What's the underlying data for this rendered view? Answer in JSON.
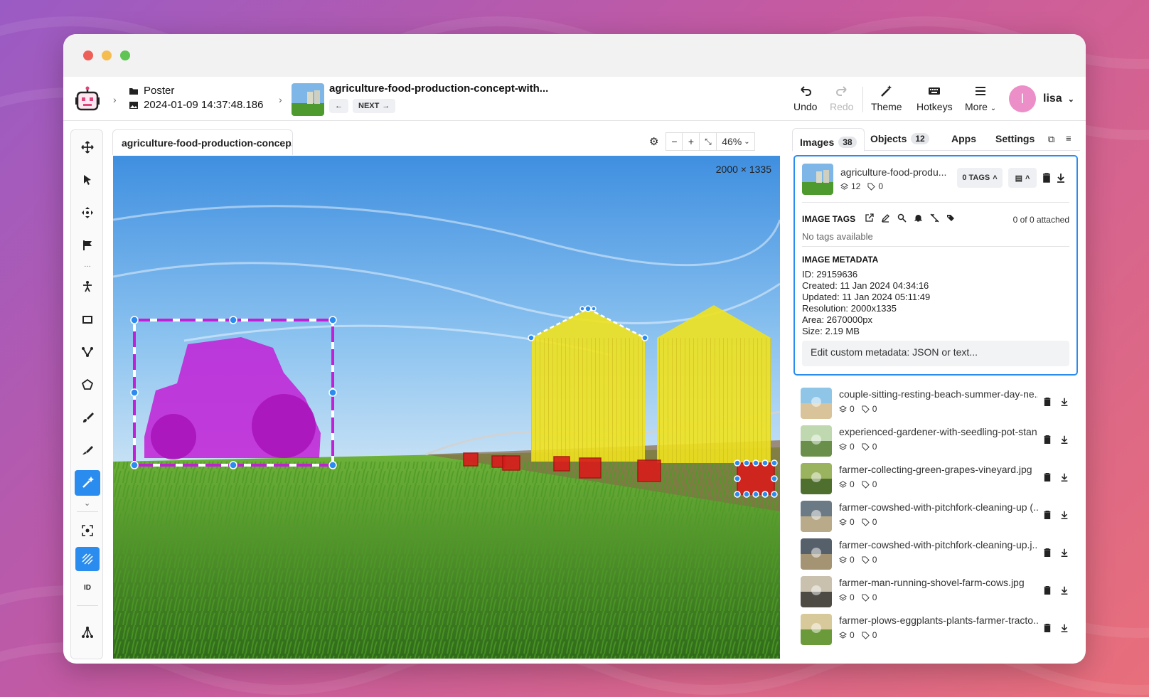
{
  "app": {
    "logo": "robot-logo-icon"
  },
  "breadcrumb": {
    "project": "Poster",
    "dataset": "2024-01-09 14:37:48.186"
  },
  "image": {
    "title": "agriculture-food-production-concept-with...",
    "prev_label": "",
    "next_label": "NEXT",
    "tab_label": "agriculture-food-production-concep...",
    "resolution_label": "2000 × 1335",
    "zoom": "46%"
  },
  "toolbar_top": {
    "undo": "Undo",
    "redo": "Redo",
    "theme": "Theme",
    "hotkeys": "Hotkeys",
    "more": "More",
    "user": "lisa",
    "user_initial": "l"
  },
  "tools": [
    "move-icon",
    "pointer-icon",
    "pan-icon",
    "flag-icon",
    "keypoint-icon",
    "rectangle-icon",
    "polyline-icon",
    "polygon-icon",
    "brush-icon",
    "eraser-icon",
    "smart-tool-icon",
    "focus-icon",
    "hatch-icon",
    "id-icon",
    "graph-icon"
  ],
  "tool_id_label": "ID",
  "right_tabs": {
    "images": "Images",
    "images_count": "38",
    "objects": "Objects",
    "objects_count": "12",
    "apps": "Apps",
    "settings": "Settings"
  },
  "selected_image": {
    "name": "agriculture-food-produ...",
    "objects": "12",
    "tags": "0",
    "tags_button": "0 TAGS",
    "image_tags_title": "IMAGE TAGS",
    "attached": "0 of 0 attached",
    "no_tags": "No tags available",
    "metadata_title": "IMAGE METADATA",
    "meta": {
      "id": "ID: 29159636",
      "created": "Created: 11 Jan 2024 04:34:16",
      "updated": "Updated: 11 Jan 2024 05:11:49",
      "resolution": "Resolution: 2000x1335",
      "area": "Area: 2670000px",
      "size": "Size: 2.19 MB"
    },
    "metadata_placeholder": "Edit custom metadata: JSON or text..."
  },
  "images_list": [
    {
      "name": "couple-sitting-resting-beach-summer-day-ne...",
      "objects": "0",
      "tags": "0"
    },
    {
      "name": "experienced-gardener-with-seedling-pot-stan...",
      "objects": "0",
      "tags": "0"
    },
    {
      "name": "farmer-collecting-green-grapes-vineyard.jpg",
      "objects": "0",
      "tags": "0"
    },
    {
      "name": "farmer-cowshed-with-pitchfork-cleaning-up (...",
      "objects": "0",
      "tags": "0"
    },
    {
      "name": "farmer-cowshed-with-pitchfork-cleaning-up.j...",
      "objects": "0",
      "tags": "0"
    },
    {
      "name": "farmer-man-running-shovel-farm-cows.jpg",
      "objects": "0",
      "tags": "0"
    },
    {
      "name": "farmer-plows-eggplants-plants-farmer-tracto...",
      "objects": "0",
      "tags": "0"
    }
  ],
  "colors": {
    "accent": "#2b8cf0",
    "tractor": "#c21fd6",
    "silo": "#f0e21e",
    "sprinkler": "#d91c1c"
  }
}
